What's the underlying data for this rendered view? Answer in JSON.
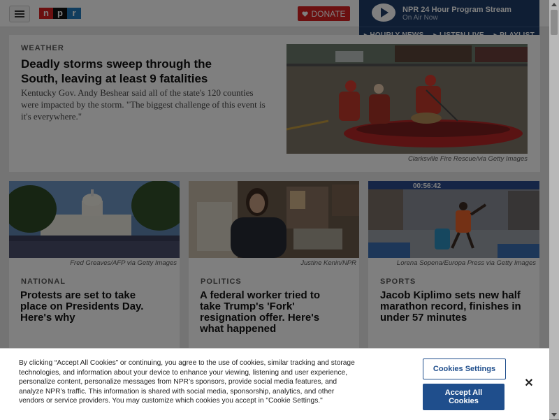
{
  "header": {
    "logo_letters": [
      "n",
      "p",
      "r"
    ],
    "logo_colors": [
      "#d62021",
      "#111111",
      "#237bbd"
    ],
    "donate_label": "DONATE"
  },
  "player": {
    "title": "NPR 24 Hour Program Stream",
    "subtitle": "On Air Now",
    "links": [
      "HOURLY NEWS",
      "LISTEN LIVE",
      "PLAYLIST"
    ]
  },
  "hero": {
    "kicker": "WEATHER",
    "headline": "Deadly storms sweep through the South, leaving at least 9 fatalities",
    "teaser": "Kentucky Gov. Andy Beshear said all of the state's 120 counties were impacted by the storm. \"The biggest challenge of this event is it's everywhere.\"",
    "credit": "Clarksville Fire Rescue/via Getty Images"
  },
  "cards": [
    {
      "credit": "Fred Greaves/AFP via Getty Images",
      "kicker": "NATIONAL",
      "headline": "Protests are set to take place on Presidents Day. Here's why"
    },
    {
      "credit": "Justine Kenin/NPR",
      "kicker": "POLITICS",
      "headline": "A federal worker tried to take Trump's 'Fork' resignation offer. Here's what happened"
    },
    {
      "credit": "Lorena Sopena/Europa Press via Getty Images",
      "kicker": "SPORTS",
      "headline": "Jacob Kiplimo sets new half marathon record, finishes in under 57 minutes",
      "clock": "00:56:42"
    }
  ],
  "cookie": {
    "text": "By clicking “Accept All Cookies” or continuing, you agree to the use of cookies, similar tracking and storage technologies, and information about your device to enhance your viewing, listening and user experience, personalize content, personalize messages from NPR’s sponsors, provide social media features, and analyze NPR’s traffic. This information is shared with social media, sponsorship, analytics, and other vendors or service providers. You may customize which cookies you accept in \"Cookie Settings.\"",
    "settings_label": "Cookies Settings",
    "accept_label": "Accept All Cookies",
    "close_label": "✕"
  },
  "colors": {
    "donate": "#d62021",
    "player": "#1e3d69",
    "cookie_button": "#1f4e8c"
  }
}
